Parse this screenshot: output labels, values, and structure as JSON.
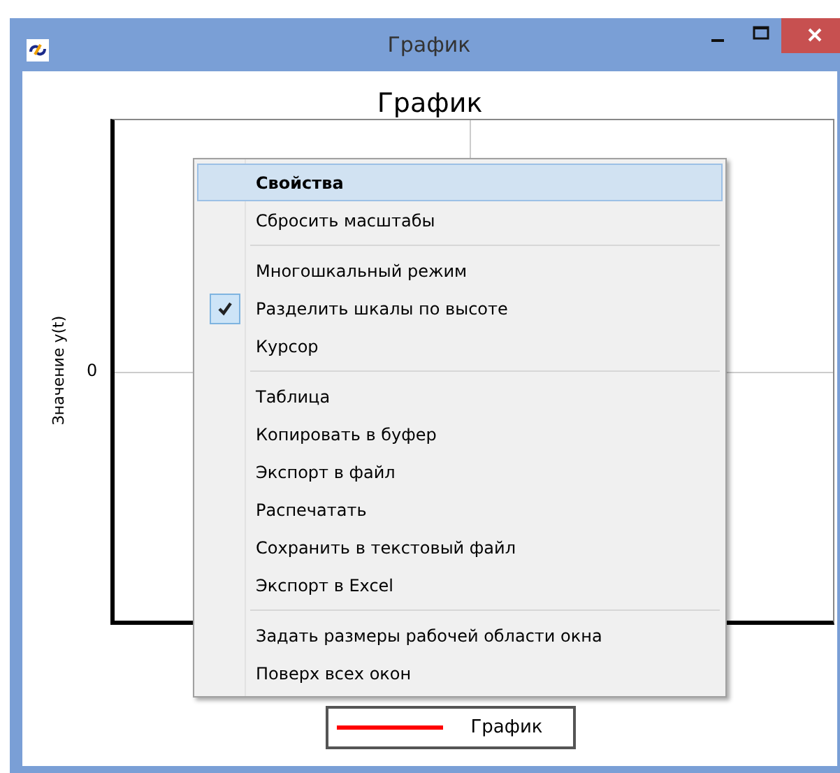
{
  "window": {
    "title": "График"
  },
  "chart": {
    "title": "График",
    "ylabel": "Значение y(t)",
    "yticks": [
      "0"
    ]
  },
  "legend": {
    "label": "График",
    "color": "#ff0000"
  },
  "context_menu": [
    {
      "kind": "item",
      "label": "Свойства",
      "selected": true,
      "checked": false,
      "default": true
    },
    {
      "kind": "item",
      "label": "Сбросить масштабы",
      "selected": false,
      "checked": false,
      "default": false
    },
    {
      "kind": "separator"
    },
    {
      "kind": "item",
      "label": "Многошкальный режим",
      "selected": false,
      "checked": false,
      "default": false
    },
    {
      "kind": "item",
      "label": "Разделить шкалы по высоте",
      "selected": false,
      "checked": true,
      "default": false
    },
    {
      "kind": "item",
      "label": "Курсор",
      "selected": false,
      "checked": false,
      "default": false
    },
    {
      "kind": "separator"
    },
    {
      "kind": "item",
      "label": "Таблица",
      "selected": false,
      "checked": false,
      "default": false
    },
    {
      "kind": "item",
      "label": "Копировать в буфер",
      "selected": false,
      "checked": false,
      "default": false
    },
    {
      "kind": "item",
      "label": "Экспорт в файл",
      "selected": false,
      "checked": false,
      "default": false
    },
    {
      "kind": "item",
      "label": "Распечатать",
      "selected": false,
      "checked": false,
      "default": false
    },
    {
      "kind": "item",
      "label": "Сохранить в текстовый файл",
      "selected": false,
      "checked": false,
      "default": false
    },
    {
      "kind": "item",
      "label": "Экспорт в Excel",
      "selected": false,
      "checked": false,
      "default": false
    },
    {
      "kind": "separator"
    },
    {
      "kind": "item",
      "label": "Задать размеры рабочей области окна",
      "selected": false,
      "checked": false,
      "default": false
    },
    {
      "kind": "item",
      "label": "Поверх всех окон",
      "selected": false,
      "checked": false,
      "default": false
    }
  ]
}
